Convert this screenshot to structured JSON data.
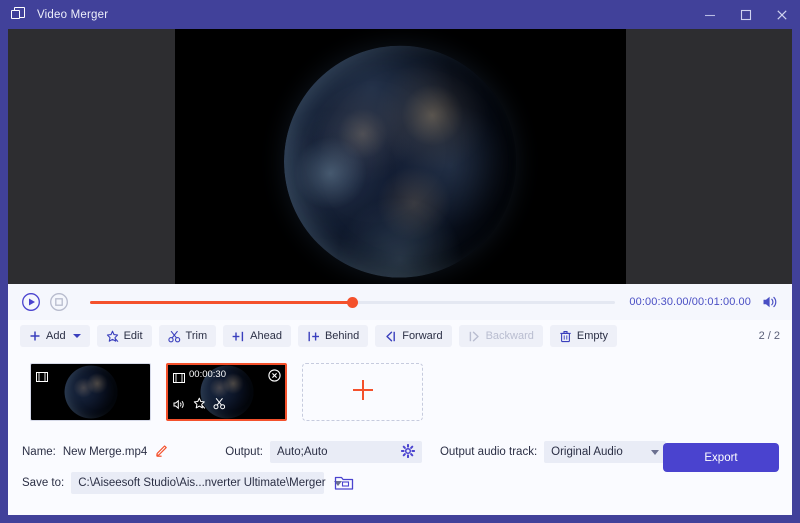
{
  "window": {
    "title": "Video Merger",
    "app_icon": "video-merger-icon",
    "controls": {
      "minimize": "minimize-icon",
      "maximize": "maximize-icon",
      "close": "close-icon"
    },
    "frame_color": "#41419a"
  },
  "preview": {
    "video_background": "#000000",
    "stage_background": "#2d2d30",
    "content": "night-earth-from-space"
  },
  "transport": {
    "play_label": "play-icon",
    "stop_label": "stop-icon",
    "progress_percent": 50,
    "time": "00:00:30.00/00:01:00.00",
    "current_time": "00:00:30.00",
    "total_time": "00:01:00.00",
    "volume_label": "volume-icon",
    "accent_color": "#f4512c"
  },
  "toolbar": {
    "buttons": [
      {
        "label": "Add",
        "icon": "plus-icon",
        "has_caret": true,
        "disabled": false
      },
      {
        "label": "Edit",
        "icon": "magic-wand-icon",
        "has_caret": false,
        "disabled": false
      },
      {
        "label": "Trim",
        "icon": "scissors-icon",
        "has_caret": false,
        "disabled": false
      },
      {
        "label": "Ahead",
        "icon": "insert-ahead-icon",
        "has_caret": false,
        "disabled": false
      },
      {
        "label": "Behind",
        "icon": "insert-behind-icon",
        "has_caret": false,
        "disabled": false
      },
      {
        "label": "Forward",
        "icon": "move-forward-icon",
        "has_caret": false,
        "disabled": false
      },
      {
        "label": "Backward",
        "icon": "move-backward-icon",
        "has_caret": false,
        "disabled": true
      },
      {
        "label": "Empty",
        "icon": "trash-icon",
        "has_caret": false,
        "disabled": false
      }
    ],
    "page_counter": "2 / 2",
    "page_current": "2",
    "page_total": "2"
  },
  "clips": [
    {
      "duration": "",
      "selected": false,
      "film_icon": "film-strip-icon",
      "thumbnail": "night-earth-thumbnail"
    },
    {
      "duration": "00:00:30",
      "selected": true,
      "film_icon": "film-strip-icon",
      "close_icon": "remove-clip-icon",
      "tools": [
        "volume-icon",
        "magic-wand-icon",
        "scissors-icon"
      ],
      "thumbnail": "night-earth-thumbnail"
    }
  ],
  "add_clip": {
    "icon": "plus-icon",
    "color": "#f4512c"
  },
  "settings": {
    "name_label": "Name:",
    "name_value": "New Merge.mp4",
    "name_edit_icon": "pencil-icon",
    "output_label": "Output:",
    "output_value": "Auto;Auto",
    "output_gear_icon": "gear-icon",
    "audio_track_label": "Output audio track:",
    "audio_track_value": "Original Audio",
    "save_to_label": "Save to:",
    "save_to_value": "C:\\Aiseesoft Studio\\Ais...nverter Ultimate\\Merger",
    "browse_icon": "folder-icon",
    "export_label": "Export",
    "export_color": "#4a43cf"
  }
}
